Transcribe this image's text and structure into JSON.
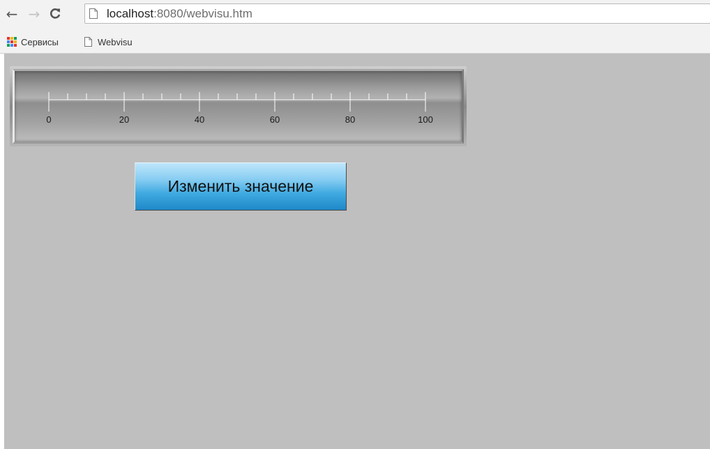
{
  "browser": {
    "url_host": "localhost",
    "url_rest": ":8080/webvisu.htm",
    "bookmarks": [
      {
        "label": "Сервисы",
        "icon": "apps-icon"
      },
      {
        "label": "Webvisu",
        "icon": "page-icon"
      }
    ]
  },
  "visu": {
    "scale": {
      "min": 0,
      "max": 100,
      "major_step": 20,
      "minor_step": 5,
      "tick_labels": [
        "0",
        "20",
        "40",
        "60",
        "80",
        "100"
      ]
    },
    "button_label": "Изменить значение"
  },
  "colors": {
    "visu_background": "#bfbfbf",
    "button_blue": "#3fa9e0"
  }
}
